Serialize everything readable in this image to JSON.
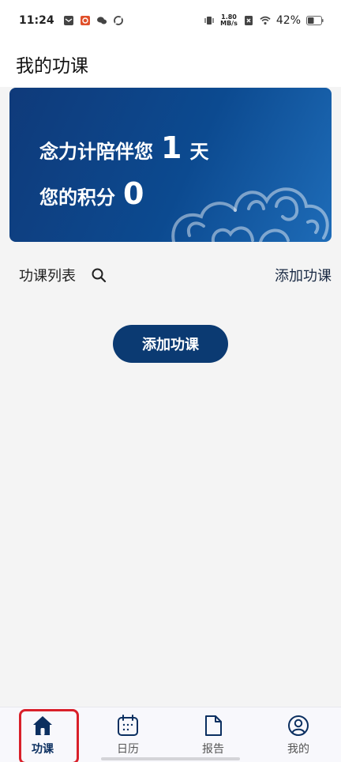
{
  "status_bar": {
    "time": "11:24",
    "speed_value": "1.80",
    "speed_unit": "MB/s",
    "battery": "42%"
  },
  "header": {
    "title": "我的功课"
  },
  "banner": {
    "days_text": "念力计陪伴您",
    "days_value": "1",
    "days_unit": "天",
    "points_text": "您的积分",
    "points_value": "0"
  },
  "list": {
    "title": "功课列表",
    "add_link": "添加功课",
    "add_button": "添加功课"
  },
  "tabs": [
    {
      "label": "功课",
      "icon": "home-icon"
    },
    {
      "label": "日历",
      "icon": "calendar-icon"
    },
    {
      "label": "报告",
      "icon": "document-icon"
    },
    {
      "label": "我的",
      "icon": "profile-icon"
    }
  ],
  "colors": {
    "accent": "#0b3a72",
    "banner_start": "#0f3a7a",
    "banner_end": "#1e6cb8",
    "highlight": "#d9202a"
  }
}
